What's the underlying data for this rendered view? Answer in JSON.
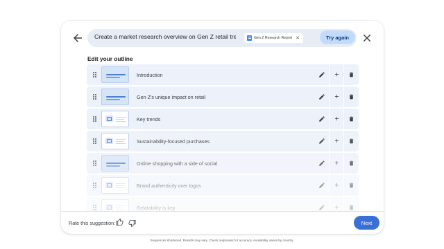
{
  "prompt": {
    "text": "Create a market research overview on Gen Z retail trends using",
    "file_chip": {
      "label": "Gen Z Research Report",
      "icon": "doc-icon",
      "color": "#4285f4"
    },
    "try_again_label": "Try again"
  },
  "header": {
    "back_icon": "arrow-back-icon",
    "close_icon": "close-icon"
  },
  "outline": {
    "title": "Edit your outline",
    "items": [
      {
        "label": "Introduction",
        "thumbnail": "title-layout",
        "opacity": 1.0
      },
      {
        "label": "Gen Z's unique impact on retail",
        "thumbnail": "title-layout",
        "opacity": 1.0
      },
      {
        "label": "Key trends",
        "thumbnail": "content-layout",
        "opacity": 1.0
      },
      {
        "label": "Sustainability-focused purchases",
        "thumbnail": "content-layout",
        "opacity": 0.9
      },
      {
        "label": "Online shopping with a side of social",
        "thumbnail": "title-layout",
        "opacity": 0.75
      },
      {
        "label": "Brand authenticity over logos",
        "thumbnail": "content-layout",
        "opacity": 0.5
      },
      {
        "label": "Relatability is key",
        "thumbnail": "content-layout",
        "opacity": 0.3
      }
    ],
    "row_actions": {
      "edit_icon": "pencil-icon",
      "add_icon": "plus-icon",
      "delete_icon": "trash-icon",
      "drag_icon": "drag-handle-icon"
    }
  },
  "footer": {
    "rate_label": "Rate this suggestion:",
    "thumbs_up_icon": "thumbs-up-icon",
    "thumbs_down_icon": "thumbs-down-icon",
    "next_label": "Next"
  },
  "disclaimer": "Sequences shortened. Results may vary. Check responses for accuracy. Availability varies by country.",
  "colors": {
    "accent": "#3b6fd8",
    "row_bg": "#edf2fa",
    "prompt_bg": "#e8edf5",
    "try_again_bg": "#c2dbfc"
  }
}
